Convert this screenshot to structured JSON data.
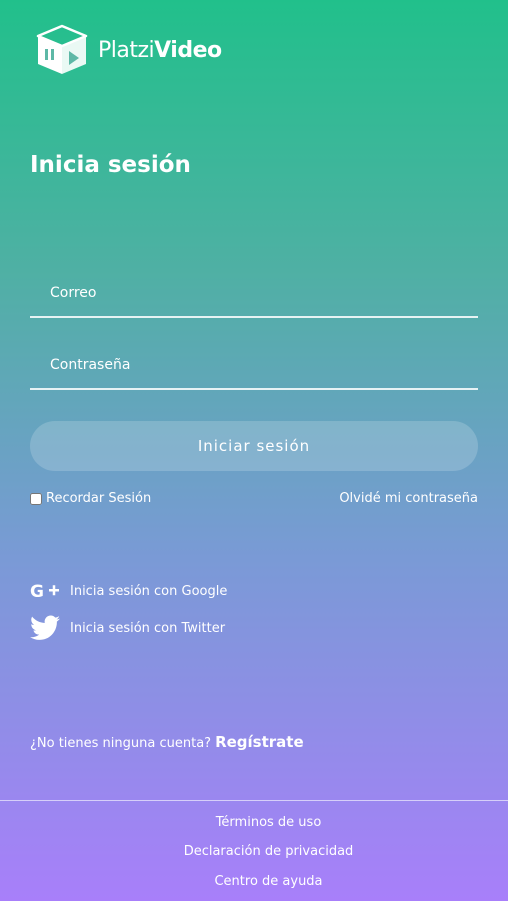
{
  "brand": {
    "name_light": "Platzi",
    "name_bold": "Video"
  },
  "login": {
    "title": "Inicia sesión",
    "email_placeholder": "Correo",
    "password_placeholder": "Contraseña",
    "submit_label": "Iniciar sesión",
    "remember_label": "Recordar Sesión",
    "remember_checked": false,
    "forgot_label": "Olvidé mi contraseña"
  },
  "social": {
    "google_label": "Inicia sesión con Google",
    "google_icon": "google-plus-icon",
    "twitter_label": "Inicia sesión con Twitter",
    "twitter_icon": "twitter-icon"
  },
  "register": {
    "prompt": "¿No tienes ninguna cuenta?",
    "link_label": "Regístrate"
  },
  "footer": {
    "links": [
      "Términos de uso",
      "Declaración de privacidad",
      "Centro de ayuda"
    ]
  },
  "colors": {
    "gradient_top": "#21c08b",
    "gradient_bottom": "#a87ffa",
    "text": "#ffffff"
  }
}
